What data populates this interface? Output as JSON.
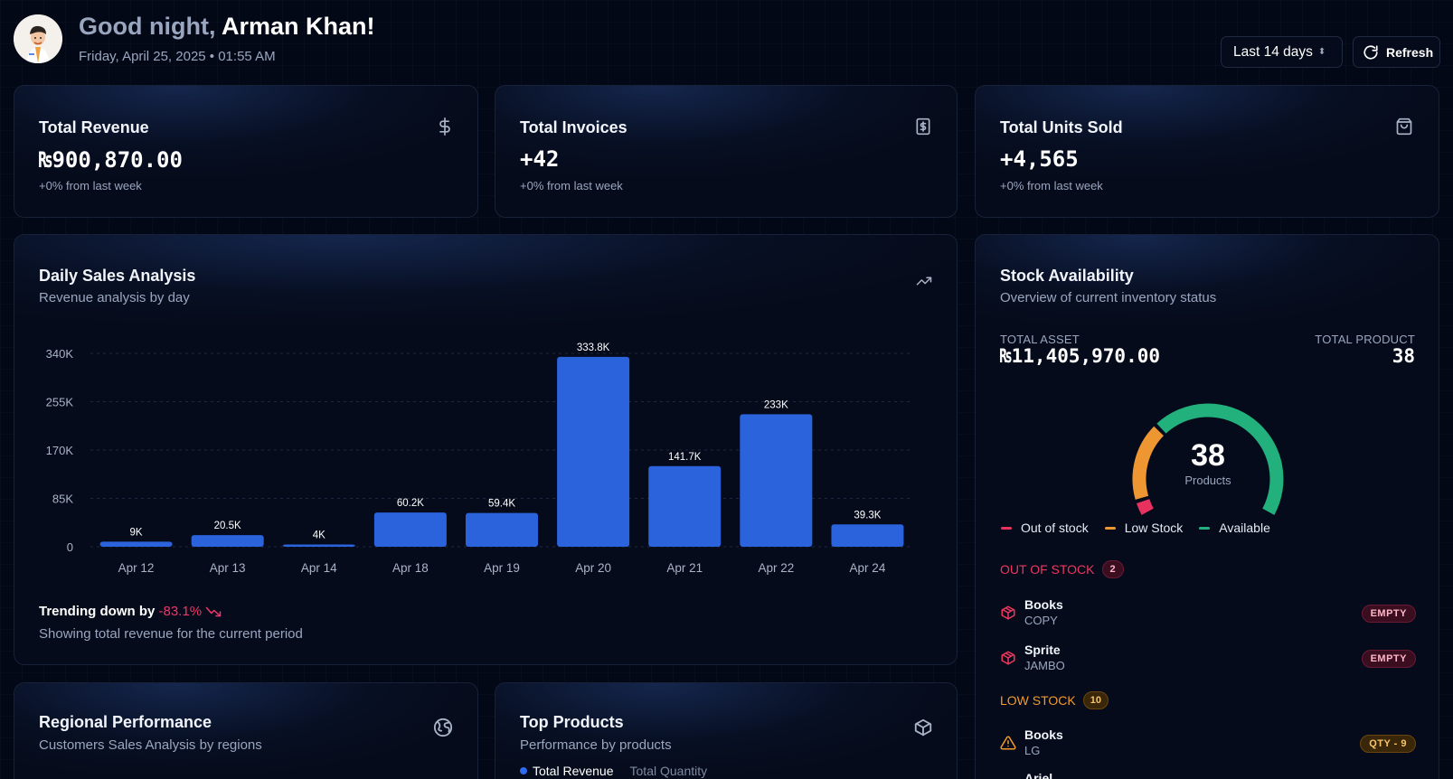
{
  "header": {
    "greeting": "Good night,",
    "user_name": "Arman Khan!",
    "datetime": "Friday, April 25, 2025 • 01:55 AM",
    "range_label": "Last 14 days",
    "refresh_label": "Refresh"
  },
  "kpis": [
    {
      "title": "Total Revenue",
      "value": "₨900,870.00",
      "note": "+0% from last week",
      "icon": "dollar-icon"
    },
    {
      "title": "Total Invoices",
      "value": "+42",
      "note": "+0% from last week",
      "icon": "receipt-icon"
    },
    {
      "title": "Total Units Sold",
      "value": "+4,565",
      "note": "+0% from last week",
      "icon": "shopping-bag-icon"
    }
  ],
  "daily_sales": {
    "title": "Daily Sales Analysis",
    "subtitle": "Revenue analysis by day",
    "trend_label": "Trending down by",
    "trend_value": "-83.1%",
    "footer": "Showing total revenue for the current period",
    "bar_color": "#2a63dc"
  },
  "chart_data": {
    "type": "bar",
    "categories": [
      "Apr 12",
      "Apr 13",
      "Apr 14",
      "Apr 18",
      "Apr 19",
      "Apr 20",
      "Apr 21",
      "Apr 22",
      "Apr 24"
    ],
    "values": [
      9000,
      20500,
      4000,
      60200,
      59400,
      333800,
      141700,
      233000,
      39300
    ],
    "data_labels": [
      "9K",
      "20.5K",
      "4K",
      "60.2K",
      "59.4K",
      "333.8K",
      "141.7K",
      "233K",
      "39.3K"
    ],
    "yticks": [
      0,
      85000,
      170000,
      255000,
      340000
    ],
    "ytick_labels": [
      "0",
      "85K",
      "170K",
      "255K",
      "340K"
    ],
    "ylim": [
      0,
      340000
    ],
    "grid": true
  },
  "stock": {
    "title": "Stock Availability",
    "subtitle": "Overview of current inventory status",
    "total_asset_label": "TOTAL ASSET",
    "total_asset_value": "₨11,405,970.00",
    "total_product_label": "TOTAL PRODUCT",
    "total_product_value": "38",
    "gauge_value": "38",
    "gauge_caption": "Products",
    "gauge": {
      "out_of_stock": 2,
      "low_stock": 10,
      "available": 26,
      "total": 38
    },
    "legend": [
      {
        "label": "Out of stock",
        "color": "#e8315e"
      },
      {
        "label": "Low Stock",
        "color": "#ee9632"
      },
      {
        "label": "Available",
        "color": "#22b07d"
      }
    ],
    "out_of_stock_label": "OUT OF STOCK",
    "out_of_stock_count": "2",
    "low_stock_label": "LOW STOCK",
    "low_stock_count": "10",
    "out_items": [
      {
        "name": "Books",
        "category": "COPY",
        "status": "EMPTY"
      },
      {
        "name": "Sprite",
        "category": "JAMBO",
        "status": "EMPTY"
      }
    ],
    "low_items": [
      {
        "name": "Books",
        "category": "LG",
        "status": "QTY - 9"
      },
      {
        "name": "Ariel"
      }
    ]
  },
  "regional": {
    "title": "Regional Performance",
    "subtitle": "Customers Sales Analysis by regions"
  },
  "top_products": {
    "title": "Top Products",
    "subtitle": "Performance by products",
    "tab_revenue": "Total Revenue",
    "tab_quantity": "Total Quantity"
  }
}
